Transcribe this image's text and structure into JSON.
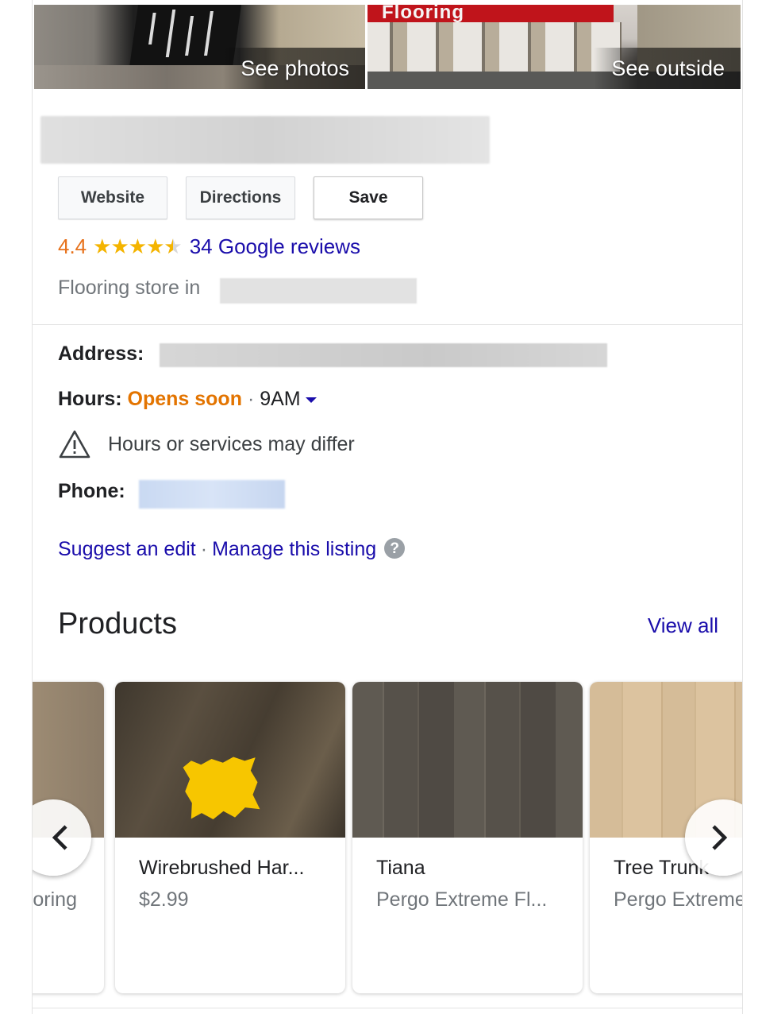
{
  "photos": {
    "left_label": "See photos",
    "right_label": "See outside",
    "store_sign_fragment": "Flooring"
  },
  "actions": {
    "website": "Website",
    "directions": "Directions",
    "save": "Save"
  },
  "rating": {
    "value": "4.4",
    "stars": "★★★★",
    "half_star": "★",
    "reviews_link": "34 Google reviews",
    "score": 4.4
  },
  "category": {
    "prefix": "Flooring store in"
  },
  "details": {
    "address_label": "Address:",
    "hours_label": "Hours:",
    "hours_status": "Opens soon",
    "hours_sep": "·",
    "hours_time": "9AM",
    "notice": "Hours or services may differ",
    "phone_label": "Phone:"
  },
  "links": {
    "suggest_edit": "Suggest an edit",
    "sep": "·",
    "manage_listing": "Manage this listing",
    "help_glyph": "?"
  },
  "products": {
    "title": "Products",
    "view_all": "View all",
    "items": [
      {
        "name": "",
        "subtitle": "ooring"
      },
      {
        "name": "Wirebrushed Har...",
        "subtitle": "$2.99"
      },
      {
        "name": "Tiana",
        "subtitle": "Pergo Extreme Fl..."
      },
      {
        "name": "Tree Trunk",
        "subtitle": "Pergo Extreme"
      }
    ]
  },
  "colors": {
    "link": "#1a0dab",
    "rating": "#e7711b",
    "star": "#f4b400",
    "opens_soon": "#e37400"
  },
  "icons": {
    "warning": "warning-triangle-icon",
    "prev": "chevron-left-icon",
    "next": "chevron-right-icon",
    "help": "help-circle-icon"
  }
}
